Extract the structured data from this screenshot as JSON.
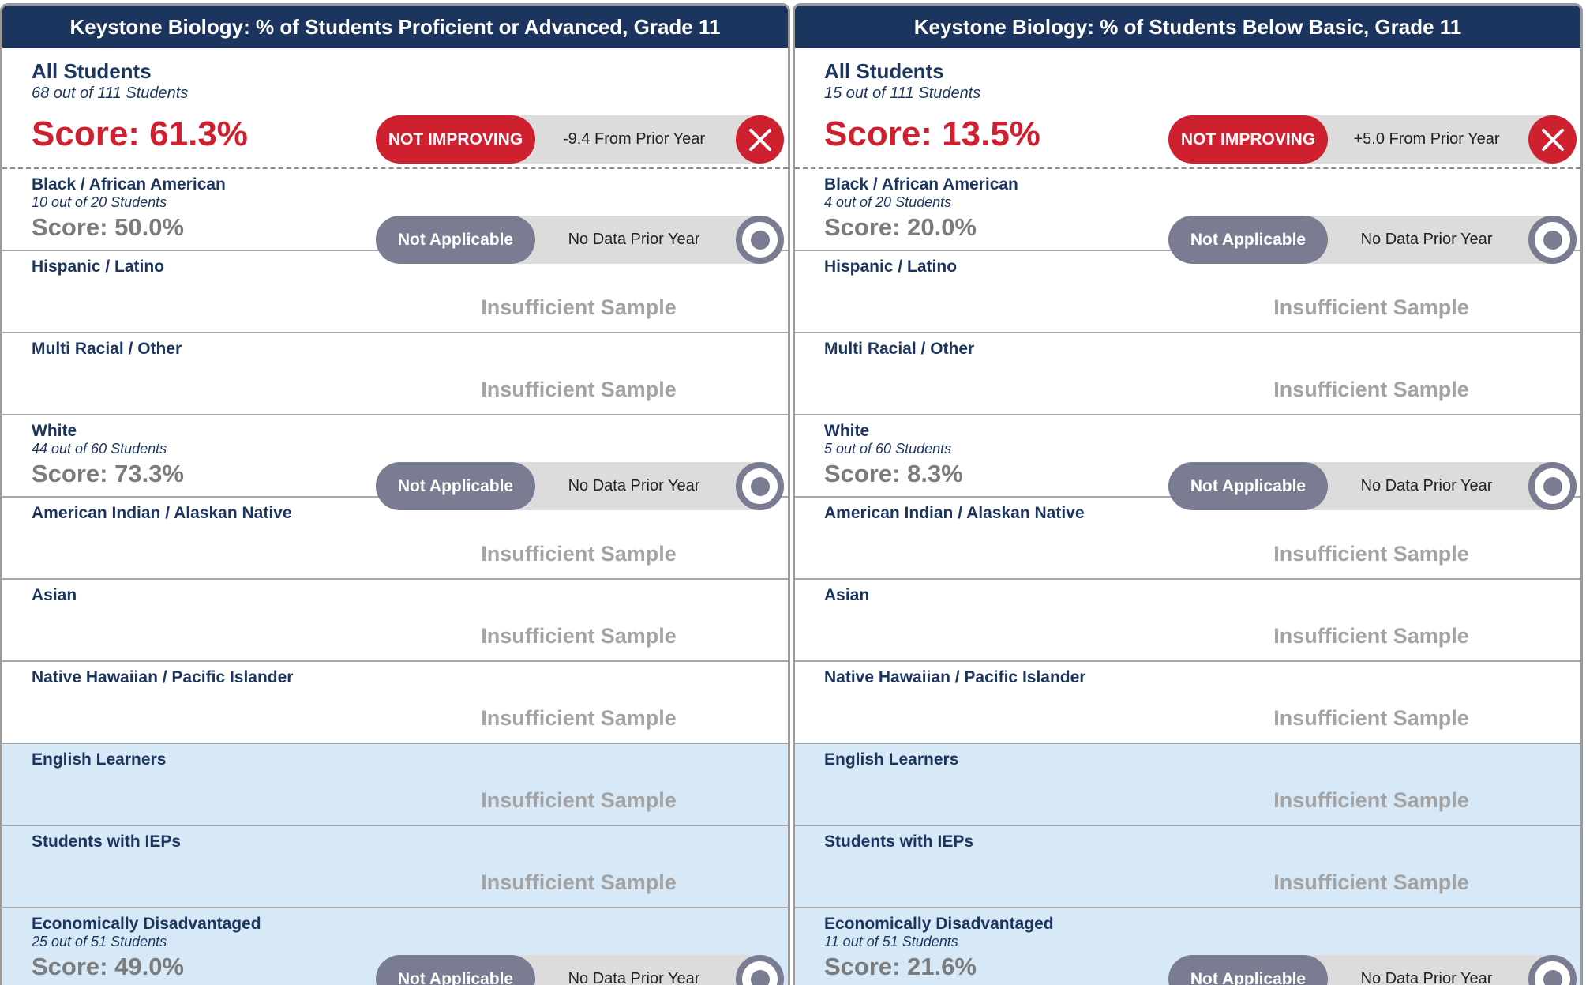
{
  "colors": {
    "header_bg": "#1c355e",
    "label_navy": "#1c355e",
    "alert_red": "#cf2030",
    "neutral_gray": "#7a7d92",
    "track_gray": "#dcdcdc",
    "highlight_blue": "#d7e9f7"
  },
  "icons": {
    "not_improving": "x-circle-icon",
    "not_applicable": "ring-circle-icon"
  },
  "panels": [
    {
      "title": "Keystone Biology: % of Students Proficient or Advanced, Grade 11",
      "rows": [
        {
          "name": "All Students",
          "count": "68 out of 111 Students",
          "score": "Score: 61.3%",
          "status": "NOT IMPROVING",
          "change": "-9.4 From Prior Year"
        },
        {
          "name": "Black / African American",
          "count": "10 out of 20 Students",
          "score": "Score: 50.0%",
          "status": "Not Applicable",
          "change": "No Data Prior Year"
        },
        {
          "name": "Hispanic / Latino",
          "note": "Insufficient Sample"
        },
        {
          "name": "Multi Racial / Other",
          "note": "Insufficient Sample"
        },
        {
          "name": "White",
          "count": "44 out of 60 Students",
          "score": "Score: 73.3%",
          "status": "Not Applicable",
          "change": "No Data Prior Year"
        },
        {
          "name": "American Indian / Alaskan Native",
          "note": "Insufficient Sample"
        },
        {
          "name": "Asian",
          "note": "Insufficient Sample"
        },
        {
          "name": "Native Hawaiian / Pacific Islander",
          "note": "Insufficient Sample"
        },
        {
          "name": "English Learners",
          "note": "Insufficient Sample"
        },
        {
          "name": "Students with IEPs",
          "note": "Insufficient Sample"
        },
        {
          "name": "Economically Disadvantaged",
          "count": "25 out of 51 Students",
          "score": "Score: 49.0%",
          "status": "Not Applicable",
          "change": "No Data Prior Year"
        }
      ]
    },
    {
      "title": "Keystone Biology: % of Students Below Basic, Grade 11",
      "rows": [
        {
          "name": "All Students",
          "count": "15 out of 111 Students",
          "score": "Score: 13.5%",
          "status": "NOT IMPROVING",
          "change": "+5.0 From Prior Year"
        },
        {
          "name": "Black / African American",
          "count": "4 out of 20 Students",
          "score": "Score: 20.0%",
          "status": "Not Applicable",
          "change": "No Data Prior Year"
        },
        {
          "name": "Hispanic / Latino",
          "note": "Insufficient Sample"
        },
        {
          "name": "Multi Racial / Other",
          "note": "Insufficient Sample"
        },
        {
          "name": "White",
          "count": "5 out of 60 Students",
          "score": "Score: 8.3%",
          "status": "Not Applicable",
          "change": "No Data Prior Year"
        },
        {
          "name": "American Indian / Alaskan Native",
          "note": "Insufficient Sample"
        },
        {
          "name": "Asian",
          "note": "Insufficient Sample"
        },
        {
          "name": "Native Hawaiian / Pacific Islander",
          "note": "Insufficient Sample"
        },
        {
          "name": "English Learners",
          "note": "Insufficient Sample"
        },
        {
          "name": "Students with IEPs",
          "note": "Insufficient Sample"
        },
        {
          "name": "Economically Disadvantaged",
          "count": "11 out of 51 Students",
          "score": "Score: 21.6%",
          "status": "Not Applicable",
          "change": "No Data Prior Year"
        }
      ]
    }
  ]
}
